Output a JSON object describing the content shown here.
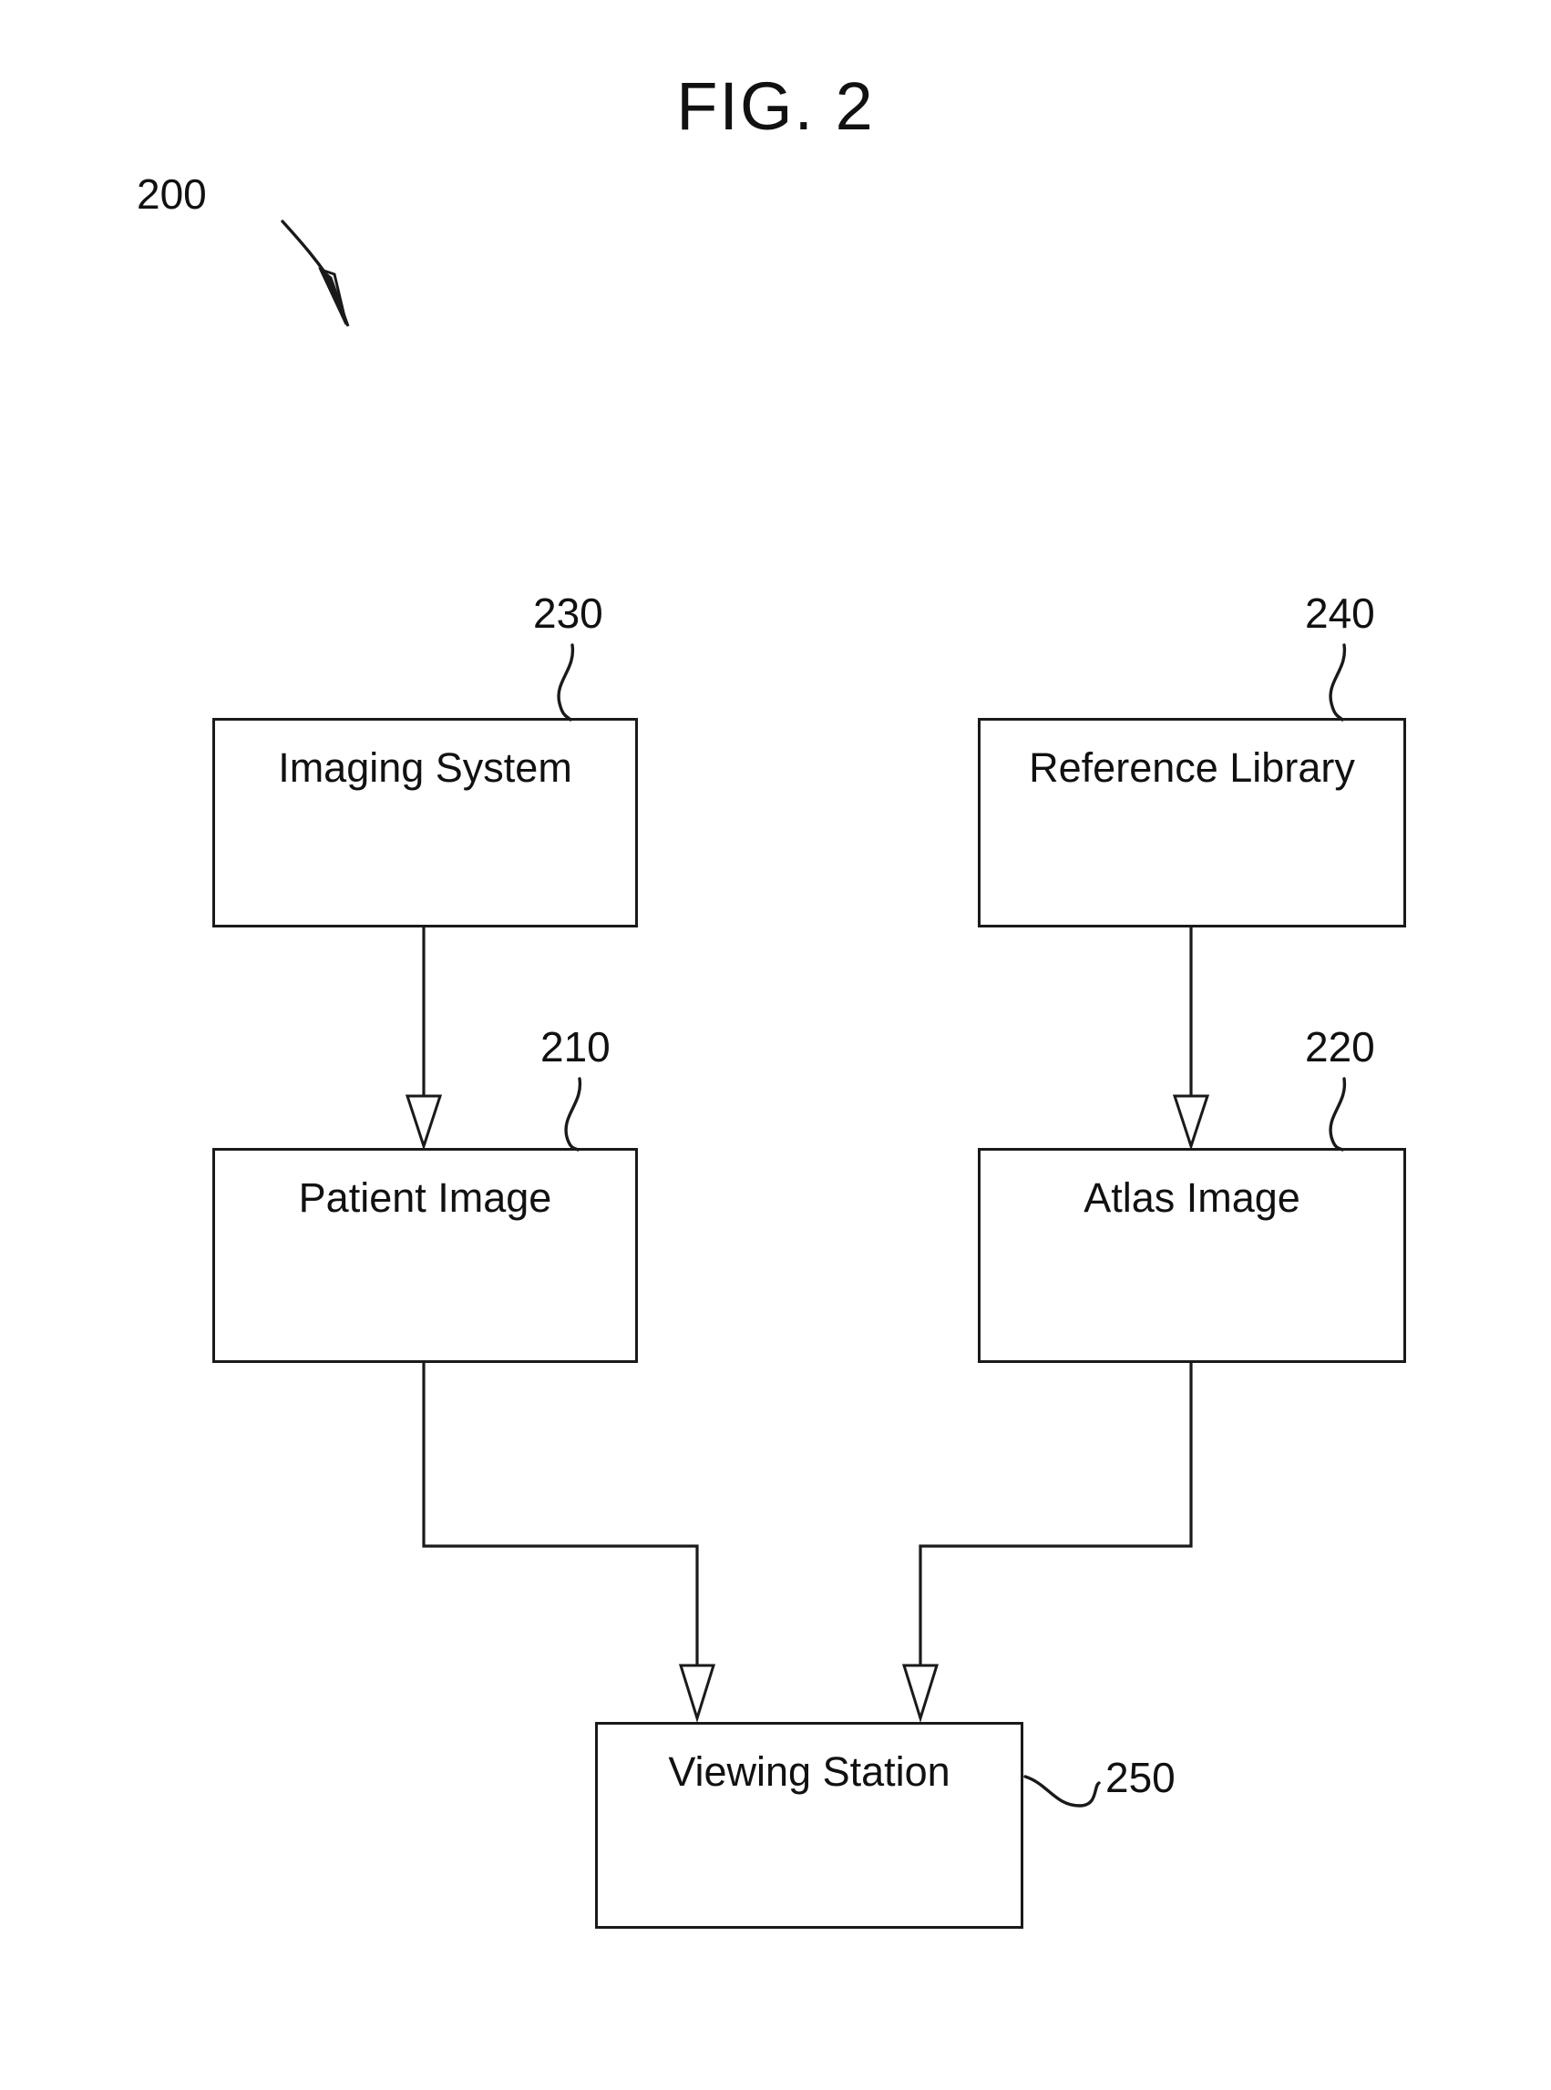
{
  "figure": {
    "title": "FIG. 2",
    "system_numeral": "200"
  },
  "nodes": [
    {
      "id": "imaging-system",
      "label": "Imaging System",
      "numeral": "230"
    },
    {
      "id": "reference-library",
      "label": "Reference Library",
      "numeral": "240"
    },
    {
      "id": "patient-image",
      "label": "Patient Image",
      "numeral": "210"
    },
    {
      "id": "atlas-image",
      "label": "Atlas Image",
      "numeral": "220"
    },
    {
      "id": "viewing-station",
      "label": "Viewing Station",
      "numeral": "250"
    }
  ],
  "connections": [
    {
      "from": "imaging-system",
      "to": "patient-image",
      "style": "straight-down"
    },
    {
      "from": "reference-library",
      "to": "atlas-image",
      "style": "straight-down"
    },
    {
      "from": "patient-image",
      "to": "viewing-station",
      "style": "elbow-right-down"
    },
    {
      "from": "atlas-image",
      "to": "viewing-station",
      "style": "elbow-left-down"
    }
  ],
  "colors": {
    "ink": "#1a1a1a",
    "paper": "#ffffff"
  }
}
